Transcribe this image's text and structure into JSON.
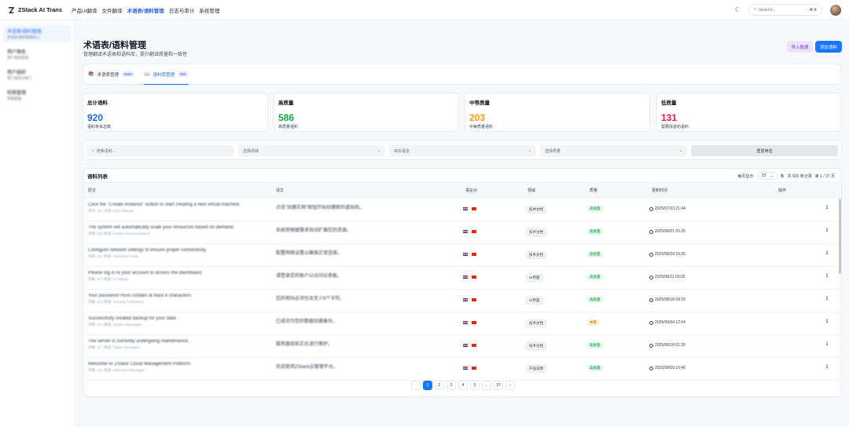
{
  "header": {
    "brand": "ZStack AI Trans",
    "nav": [
      "产品UI翻译",
      "文件翻译",
      "术语表/语料管理",
      "日志与审计",
      "系统管理"
    ],
    "nav_active_index": 2,
    "search_placeholder": "Search...",
    "search_shortcut": "⌘ K"
  },
  "sidebar": {
    "items": [
      {
        "title": "术语表/语料管理",
        "sub": "术语表/语料管理中心",
        "active": true
      },
      {
        "title": "用户角色",
        "sub": "用户角色管理",
        "active": false
      },
      {
        "title": "用户组织",
        "sub": "用户组织与部门",
        "active": false
      },
      {
        "title": "权限管理",
        "sub": "权限配置",
        "active": false
      }
    ]
  },
  "page": {
    "title": "术语表/语料管理",
    "subtitle": "管理翻译术语表和语料库，提升翻译质量和一致性",
    "import_label": "导入数据",
    "add_label": "添加语料"
  },
  "tabs": [
    {
      "icon": "📚",
      "label": "术语表管理",
      "count": "6865",
      "active": false
    },
    {
      "icon": "📖",
      "label": "语料库管理",
      "count": "920",
      "active": true
    }
  ],
  "stats": [
    {
      "label": "总计语料",
      "value": "920",
      "desc": "语料条目总数",
      "color": "#2563eb"
    },
    {
      "label": "高质量",
      "value": "586",
      "desc": "高质量语料",
      "color": "#16a34a"
    },
    {
      "label": "中等质量",
      "value": "203",
      "desc": "中等质量语料",
      "color": "#f59e0b"
    },
    {
      "label": "低质量",
      "value": "131",
      "desc": "需要改进的语料",
      "color": "#e11d48"
    }
  ],
  "filters": {
    "search_placeholder": "搜索语料...",
    "domain": "选择领域",
    "target_lang": "目标语言",
    "quality": "选择质量",
    "reset": "重置筛选"
  },
  "table": {
    "title": "语料列表",
    "page_size_label": "每页显示:",
    "page_size": "25",
    "page_size_unit": "条",
    "total_info": "共 920 条记录",
    "page_info": "第 1 / 37 页",
    "columns": [
      "原文",
      "译文",
      "语言对",
      "领域",
      "质量",
      "更新时间",
      "操作"
    ],
    "rows": [
      {
        "src": "Click the \"Create Instance\" button to start creating a new virtual machine.",
        "src_sub": "字符: 72 | 词语: User Manual",
        "tgt": "点击\"创建实例\"按钮开始创建新的虚拟机。",
        "domain": "技术文档",
        "quality": "高质量",
        "q": "high",
        "time": "2025/07/23 21:44"
      },
      {
        "src": "The system will automatically scale your resources based on demand.",
        "src_sub": "字数: 68 | 来源: Product Documentation",
        "tgt": "系统将根据需求自动扩展您的资源。",
        "domain": "技术文档",
        "quality": "高质量",
        "q": "high",
        "time": "2025/08/01 05:25"
      },
      {
        "src": "Configure network settings to ensure proper connectivity.",
        "src_sub": "字数: 56 | 来源: Technical Guide",
        "tgt": "配置网络设置以确保正常连接。",
        "domain": "技术文档",
        "quality": "高质量",
        "q": "high",
        "time": "2025/08/24 15:26"
      },
      {
        "src": "Please log in to your account to access the dashboard.",
        "src_sub": "字数: 54 | 来源: UI Strings",
        "tgt": "请登录您的账户以访问仪表板。",
        "domain": "UI界面",
        "quality": "高质量",
        "q": "high",
        "time": "2025/08/11 09:05"
      },
      {
        "src": "Your password must contain at least 8 characters.",
        "src_sub": "字数: 50 | 来源: Security Guidelines",
        "tgt": "您的密码必须包含至少8个字符。",
        "domain": "UI界面",
        "quality": "高质量",
        "q": "high",
        "time": "2025/08/18 09:29"
      },
      {
        "src": "Successfully created backup for your data.",
        "src_sub": "字数: 42 | 来源: System Messages",
        "tgt": "已成功为您的数据创建备份。",
        "domain": "技术文档",
        "quality": "中等",
        "q": "mid",
        "time": "2025/09/04 12:04"
      },
      {
        "src": "The server is currently undergoing maintenance.",
        "src_sub": "字数: 47 | 来源: Status Messages",
        "tgt": "服务器目前正在进行维护。",
        "domain": "技术文档",
        "quality": "高质量",
        "q": "high",
        "time": "2025/08/18 01:30"
      },
      {
        "src": "Welcome to ZStack Cloud Management Platform.",
        "src_sub": "字数: 43 | 来源: Welcome Messages",
        "tgt": "欢迎使用ZStack云管理平台。",
        "domain": "产品说明",
        "quality": "高质量",
        "q": "high",
        "time": "2025/09/09 16:40"
      }
    ],
    "pages": [
      "‹",
      "1",
      "2",
      "3",
      "4",
      "5",
      "...",
      "37",
      "›"
    ]
  }
}
